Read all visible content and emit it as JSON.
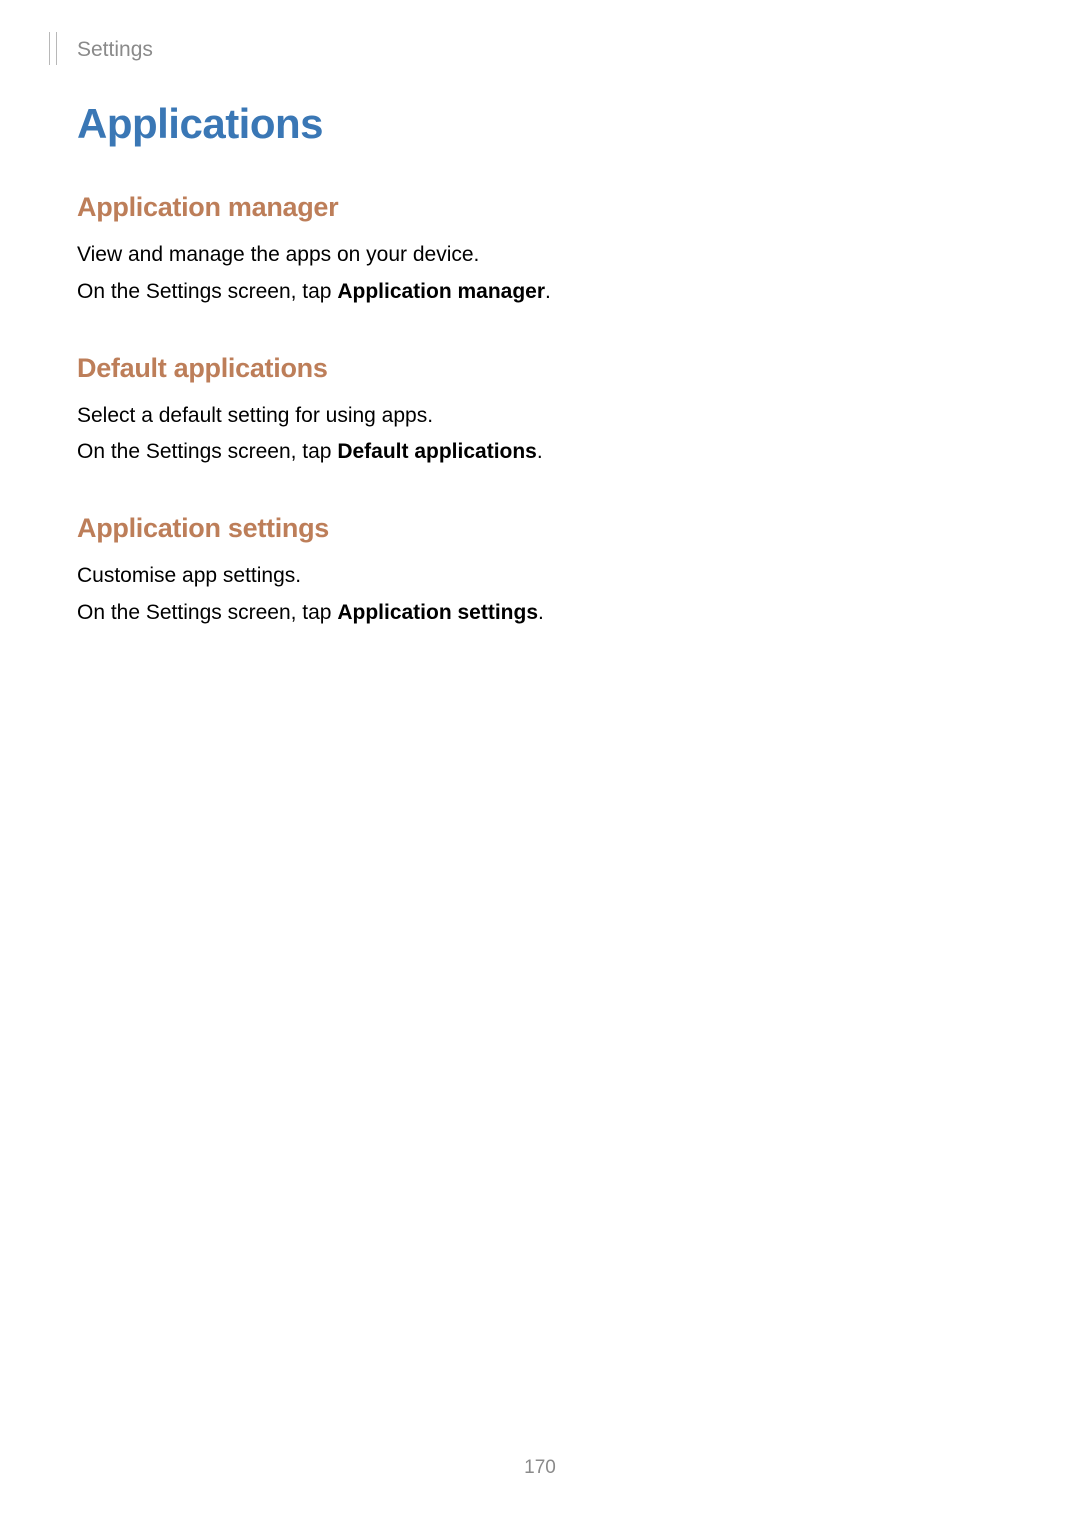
{
  "header": {
    "breadcrumb": "Settings"
  },
  "page": {
    "title": "Applications",
    "number": "170"
  },
  "sections": [
    {
      "heading": "Application manager",
      "line1": "View and manage the apps on your device.",
      "line2a": "On the Settings screen, tap ",
      "line2b": "Application manager",
      "line2c": "."
    },
    {
      "heading": "Default applications",
      "line1": "Select a default setting for using apps.",
      "line2a": "On the Settings screen, tap ",
      "line2b": "Default applications",
      "line2c": "."
    },
    {
      "heading": "Application settings",
      "line1": "Customise app settings.",
      "line2a": "On the Settings screen, tap ",
      "line2b": "Application settings",
      "line2c": "."
    }
  ]
}
